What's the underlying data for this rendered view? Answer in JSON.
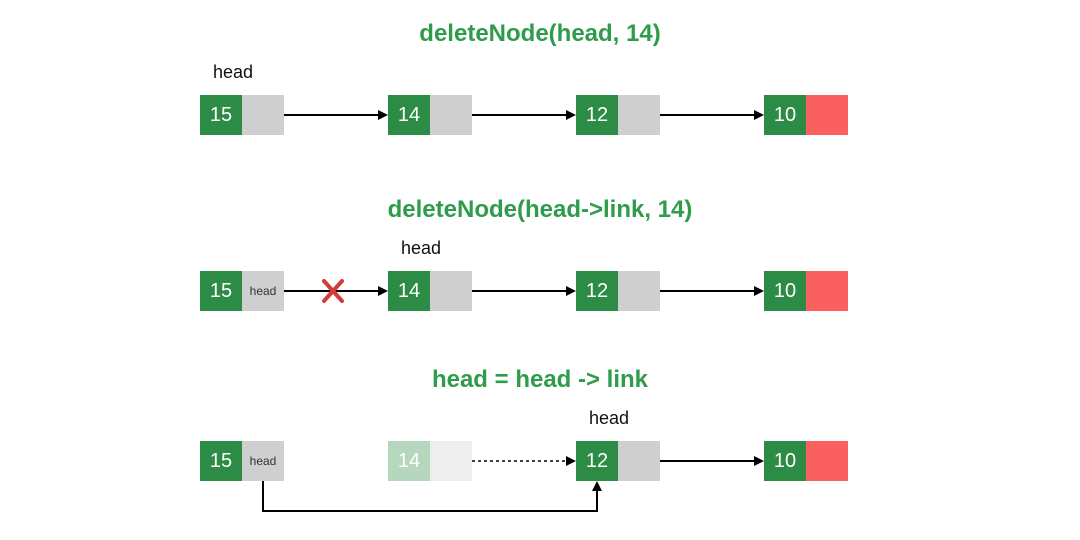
{
  "titles": {
    "t1": "deleteNode(head, 14)",
    "t2": "deleteNode(head->link, 14)",
    "t3": "head = head -> link"
  },
  "labels": {
    "head": "head"
  },
  "rows": [
    {
      "id": "r1",
      "head_label_over_index": 0,
      "nodes": [
        {
          "value": "15",
          "ptr_text": "",
          "tail": false
        },
        {
          "value": "14",
          "ptr_text": "",
          "tail": false
        },
        {
          "value": "12",
          "ptr_text": "",
          "tail": false
        },
        {
          "value": "10",
          "ptr_text": "",
          "tail": true
        }
      ],
      "arrows": [
        {
          "from": 0,
          "to": 1,
          "style": "solid",
          "crossed": false
        },
        {
          "from": 1,
          "to": 2,
          "style": "solid",
          "crossed": false
        },
        {
          "from": 2,
          "to": 3,
          "style": "solid",
          "crossed": false
        }
      ]
    },
    {
      "id": "r2",
      "head_label_over_index": 1,
      "nodes": [
        {
          "value": "15",
          "ptr_text": "head",
          "tail": false
        },
        {
          "value": "14",
          "ptr_text": "",
          "tail": false
        },
        {
          "value": "12",
          "ptr_text": "",
          "tail": false
        },
        {
          "value": "10",
          "ptr_text": "",
          "tail": true
        }
      ],
      "arrows": [
        {
          "from": 0,
          "to": 1,
          "style": "solid",
          "crossed": true
        },
        {
          "from": 1,
          "to": 2,
          "style": "solid",
          "crossed": false
        },
        {
          "from": 2,
          "to": 3,
          "style": "solid",
          "crossed": false
        }
      ]
    },
    {
      "id": "r3",
      "head_label_over_index": 2,
      "nodes": [
        {
          "value": "15",
          "ptr_text": "head",
          "tail": false
        },
        {
          "value": "14",
          "ptr_text": "",
          "tail": false,
          "faded": true
        },
        {
          "value": "12",
          "ptr_text": "",
          "tail": false
        },
        {
          "value": "10",
          "ptr_text": "",
          "tail": true
        }
      ],
      "arrows": [
        {
          "from": 1,
          "to": 2,
          "style": "dotted",
          "crossed": false
        },
        {
          "from": 2,
          "to": 3,
          "style": "solid",
          "crossed": false
        }
      ],
      "skip_arrow": {
        "from": 0,
        "to": 2
      }
    }
  ],
  "colors": {
    "green": "#2c8b44",
    "title_green": "#2e9c4a",
    "grey": "#cfcfcf",
    "red_ptr": "#f95f5f",
    "cross": "#d43b3b",
    "line": "#000000"
  }
}
